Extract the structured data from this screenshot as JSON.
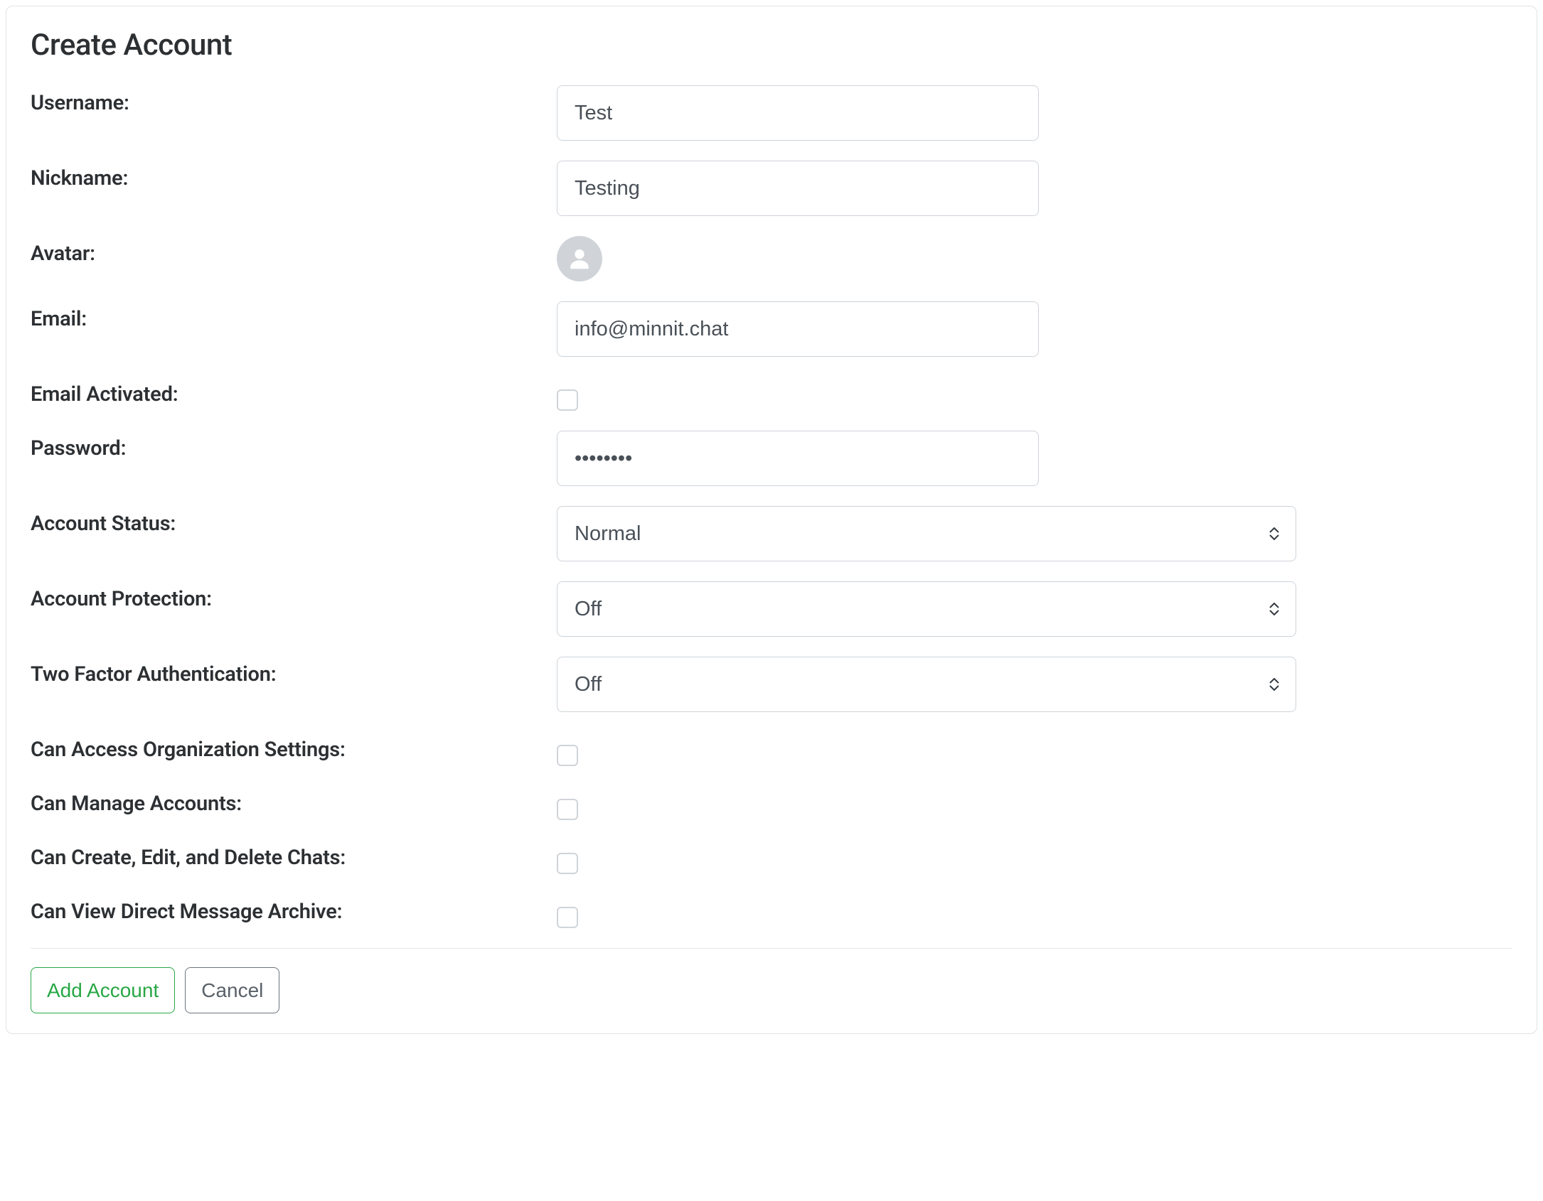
{
  "title": "Create Account",
  "fields": {
    "username": {
      "label": "Username:",
      "value": "Test"
    },
    "nickname": {
      "label": "Nickname:",
      "value": "Testing"
    },
    "avatar": {
      "label": "Avatar:"
    },
    "email": {
      "label": "Email:",
      "value": "info@minnit.chat"
    },
    "email_activated": {
      "label": "Email Activated:"
    },
    "password": {
      "label": "Password:",
      "value": "••••••••"
    },
    "account_status": {
      "label": "Account Status:",
      "value": "Normal"
    },
    "account_protection": {
      "label": "Account Protection:",
      "value": "Off"
    },
    "two_factor": {
      "label": "Two Factor Authentication:",
      "value": "Off"
    },
    "can_access_org": {
      "label": "Can Access Organization Settings:"
    },
    "can_manage_accounts": {
      "label": "Can Manage Accounts:"
    },
    "can_create_chats": {
      "label": "Can Create, Edit, and Delete Chats:"
    },
    "can_view_dm_archive": {
      "label": "Can View Direct Message Archive:"
    }
  },
  "buttons": {
    "add": "Add Account",
    "cancel": "Cancel"
  }
}
